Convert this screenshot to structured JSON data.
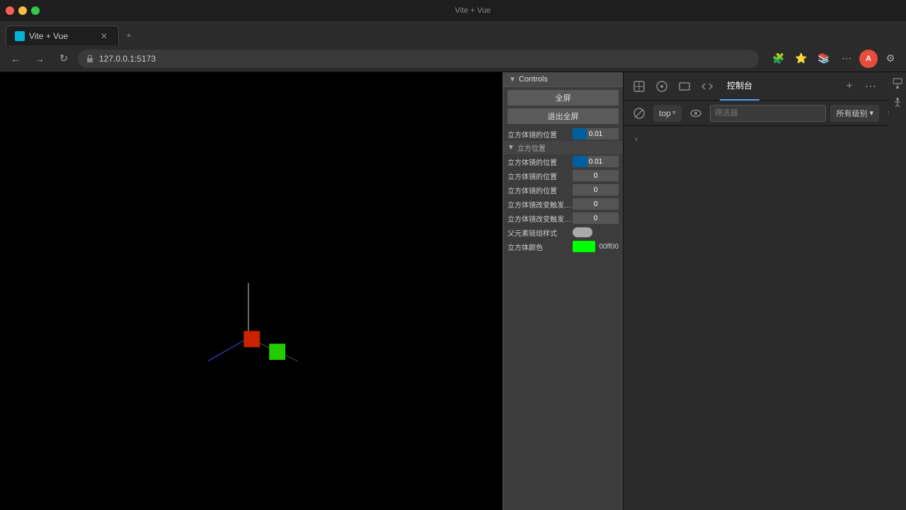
{
  "browser": {
    "tab_title": "Vite + Vue",
    "tab_favicon_color": "#00b4d8",
    "address": "127.0.0.1:5173",
    "new_tab_icon": "+",
    "back_icon": "←",
    "forward_icon": "→",
    "refresh_icon": "↻",
    "home_icon": "⌂"
  },
  "controls": {
    "header": "Controls",
    "fullscreen_btn": "全屏",
    "exit_fullscreen_btn": "退出全屏",
    "position_label": "立方体镜的位置",
    "position_value": "0.01",
    "section_label": "立方位置",
    "x_label": "立方体镜的位置",
    "x_value": "0.01",
    "y_label": "立方体镜的位置",
    "y_value": "0",
    "z_label": "立方体镜的位置",
    "z_value": "0",
    "event1_label": "立方体镜改变触发事件",
    "event1_value": "0",
    "event2_label": "立方体镜改变触发发事件",
    "event2_value": "0",
    "parent_label": "父元素链组样式",
    "cube_color_label": "立方体颜色",
    "cube_color_hex": "#00ff00",
    "cube_color_text": "00ff00"
  },
  "devtools": {
    "title": "控制台",
    "add_tab_icon": "+",
    "more_icon": "⋯",
    "close_icon": "✕",
    "inspect_icon": "🔍",
    "cursor_icon": "⊙",
    "responsive_icon": "▭",
    "code_icon": "</>",
    "top_label": "top",
    "filter_placeholder": "筛选器",
    "levels_label": "所有级别",
    "levels_arrow": "▾",
    "settings_icon": "⚙",
    "back_forward_icon": "›"
  }
}
